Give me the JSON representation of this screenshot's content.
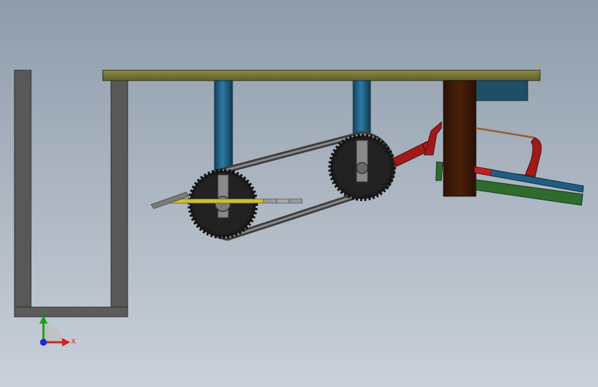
{
  "axis_triad": {
    "x_label": "X",
    "y_label": "Y",
    "x_color": "#d42020",
    "y_color": "#1aa01a",
    "z_color": "#1a2ad4"
  },
  "colors": {
    "frame": "#585858",
    "top_plate": "#7a7a3c",
    "shaft": "#1f5e82",
    "sprocket": "#222222",
    "chain": "#5a5a5a",
    "post": "#3d1a08",
    "motor_box": "#1f4f66",
    "red_link": "#a01a1a",
    "green_plate": "#2f6a2f",
    "yellow_rod": "#c8c03a"
  }
}
